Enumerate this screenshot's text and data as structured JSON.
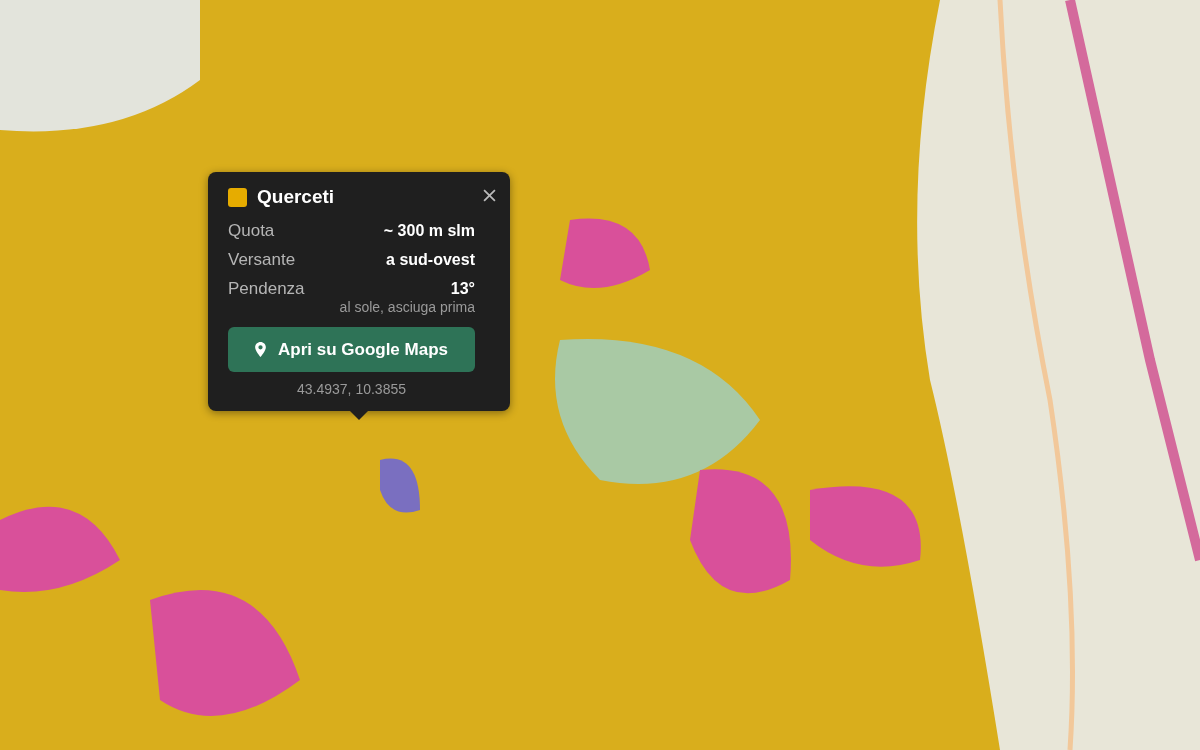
{
  "popup": {
    "title": "Querceti",
    "color": "#e6ac00",
    "rows": [
      {
        "label": "Quota",
        "value": "~ 300 m slm"
      },
      {
        "label": "Versante",
        "value": "a sud-ovest"
      },
      {
        "label": "Pendenza",
        "value": "13°"
      }
    ],
    "note": "al sole, asciuga prima",
    "button": "Apri su Google Maps",
    "coordinates": "43.4937, 10.3855"
  }
}
